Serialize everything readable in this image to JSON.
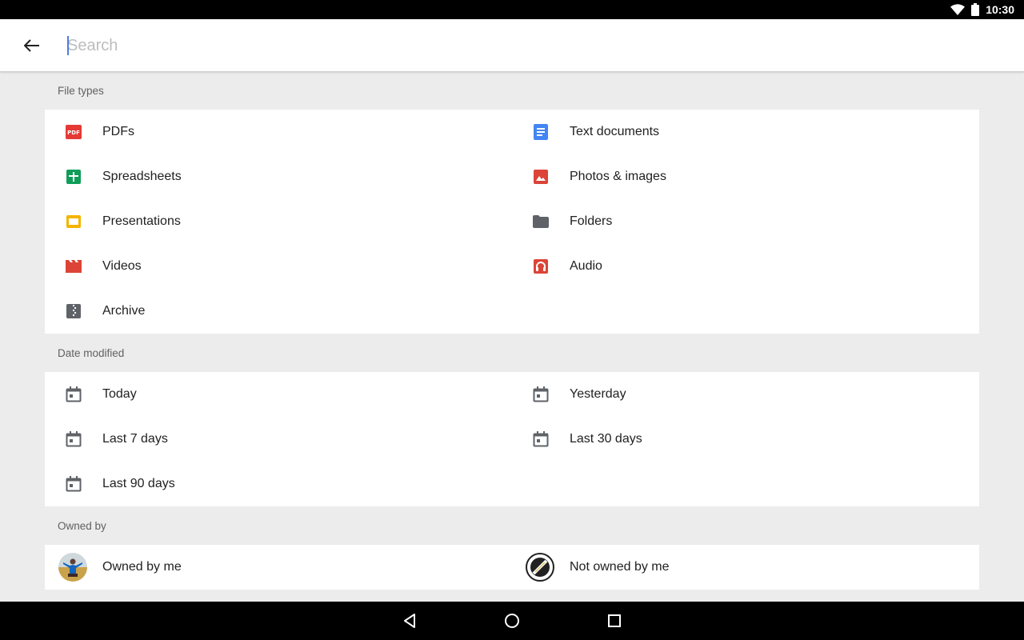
{
  "status_bar": {
    "time": "10:30",
    "icons": [
      "wifi-icon",
      "battery-icon"
    ]
  },
  "search": {
    "placeholder": "Search",
    "value": "",
    "back_icon": "arrow-back-icon"
  },
  "sections": {
    "file_types": {
      "header": "File types",
      "items": [
        {
          "label": "PDFs",
          "icon": "pdf-icon",
          "color": "#e53935"
        },
        {
          "label": "Text documents",
          "icon": "document-icon",
          "color": "#4285f4"
        },
        {
          "label": "Spreadsheets",
          "icon": "spreadsheet-icon",
          "color": "#0f9d58"
        },
        {
          "label": "Photos & images",
          "icon": "image-icon",
          "color": "#db4437"
        },
        {
          "label": "Presentations",
          "icon": "presentation-icon",
          "color": "#f4b400"
        },
        {
          "label": "Folders",
          "icon": "folder-icon",
          "color": "#5f6368"
        },
        {
          "label": "Videos",
          "icon": "video-icon",
          "color": "#db4437"
        },
        {
          "label": "Audio",
          "icon": "audio-icon",
          "color": "#db4437"
        },
        {
          "label": "Archive",
          "icon": "archive-icon",
          "color": "#5f6368"
        }
      ]
    },
    "date_modified": {
      "header": "Date modified",
      "items": [
        {
          "label": "Today",
          "icon": "calendar-icon"
        },
        {
          "label": "Yesterday",
          "icon": "calendar-icon"
        },
        {
          "label": "Last 7 days",
          "icon": "calendar-icon"
        },
        {
          "label": "Last 30 days",
          "icon": "calendar-icon"
        },
        {
          "label": "Last 90 days",
          "icon": "calendar-icon"
        }
      ]
    },
    "owned_by": {
      "header": "Owned by",
      "items": [
        {
          "label": "Owned by me",
          "icon": "avatar-me-icon"
        },
        {
          "label": "Not owned by me",
          "icon": "avatar-others-icon"
        }
      ]
    }
  },
  "nav_bar": {
    "buttons": [
      "back-triangle-icon",
      "home-circle-icon",
      "recents-square-icon"
    ]
  }
}
